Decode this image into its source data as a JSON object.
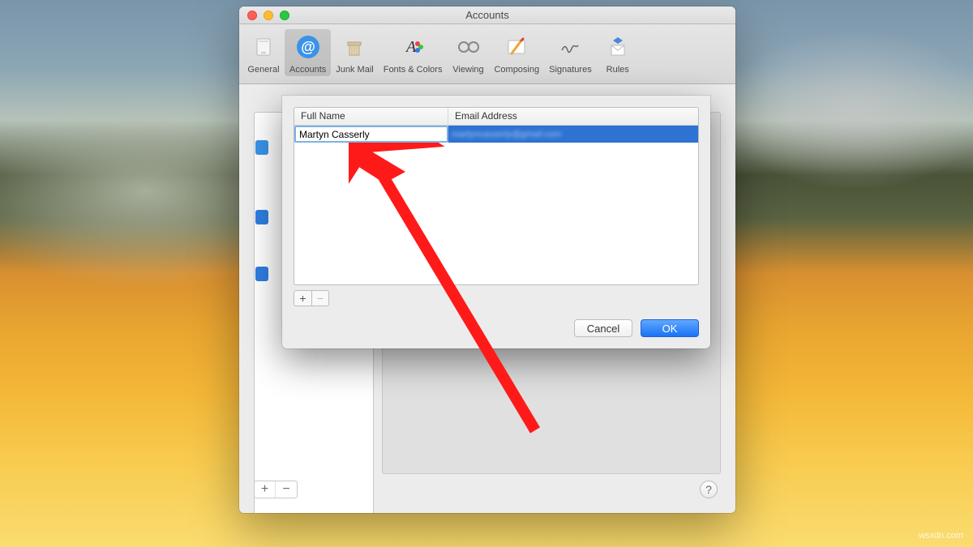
{
  "window": {
    "title": "Accounts"
  },
  "toolbar": {
    "items": [
      {
        "label": "General"
      },
      {
        "label": "Accounts"
      },
      {
        "label": "Junk Mail"
      },
      {
        "label": "Fonts & Colors"
      },
      {
        "label": "Viewing"
      },
      {
        "label": "Composing"
      },
      {
        "label": "Signatures"
      },
      {
        "label": "Rules"
      }
    ],
    "selected_index": 1
  },
  "dialog": {
    "columns": {
      "full_name": "Full Name",
      "email_address": "Email Address"
    },
    "row": {
      "full_name": "Martyn Casserly",
      "email_address": "martyncasserly@gmail.com"
    },
    "buttons": {
      "cancel": "Cancel",
      "ok": "OK"
    },
    "add_label": "+",
    "remove_label": "−"
  },
  "sidebar": {
    "add_label": "+",
    "remove_label": "−"
  },
  "help_label": "?",
  "watermark": "wsxdn.com"
}
